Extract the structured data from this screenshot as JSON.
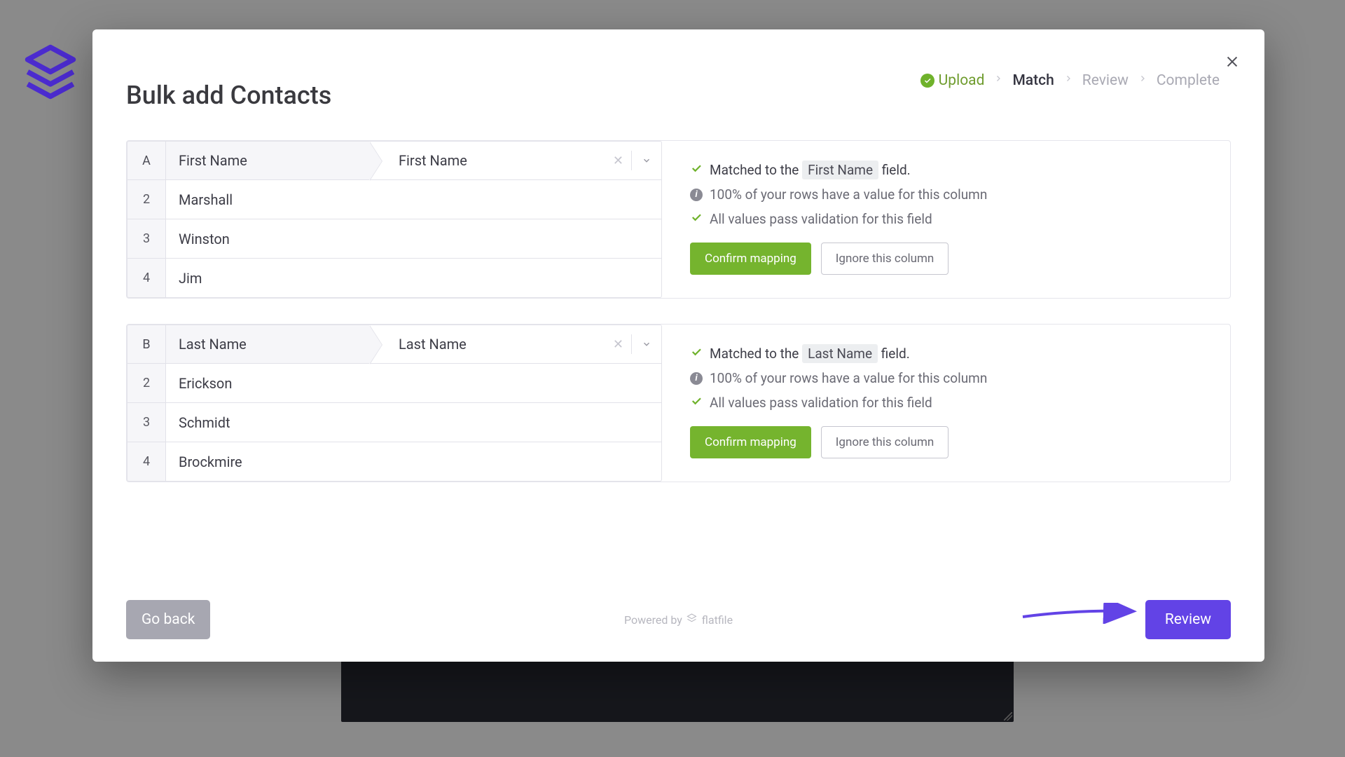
{
  "title": "Bulk add Contacts",
  "stepper": {
    "upload": "Upload",
    "match": "Match",
    "review": "Review",
    "complete": "Complete"
  },
  "columns": [
    {
      "letter": "A",
      "source_header": "First Name",
      "dest_field": "First Name",
      "rows": [
        {
          "n": "2",
          "v": "Marshall"
        },
        {
          "n": "3",
          "v": "Winston"
        },
        {
          "n": "4",
          "v": "Jim"
        }
      ],
      "matched_prefix": "Matched to the ",
      "matched_field": "First Name",
      "matched_suffix": " field.",
      "coverage": "100% of your rows have a value for this column",
      "validation": "All values pass validation for this field"
    },
    {
      "letter": "B",
      "source_header": "Last Name",
      "dest_field": "Last Name",
      "rows": [
        {
          "n": "2",
          "v": "Erickson"
        },
        {
          "n": "3",
          "v": "Schmidt"
        },
        {
          "n": "4",
          "v": "Brockmire"
        }
      ],
      "matched_prefix": "Matched to the ",
      "matched_field": "Last Name",
      "matched_suffix": " field.",
      "coverage": "100% of your rows have a value for this column",
      "validation": "All values pass validation for this field"
    }
  ],
  "buttons": {
    "confirm": "Confirm mapping",
    "ignore": "Ignore this column",
    "back": "Go back",
    "review": "Review"
  },
  "powered_by": "Powered by",
  "powered_brand": "flatfile"
}
